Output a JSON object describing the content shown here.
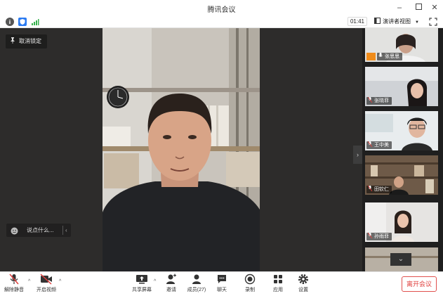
{
  "window": {
    "title": "腾讯会议"
  },
  "infobar": {
    "timer": "01:41",
    "view_mode": "演讲者视图"
  },
  "stage": {
    "pinned_label": "取消锁定",
    "chat_placeholder": "说点什么..."
  },
  "participants": [
    {
      "name": "张思思"
    },
    {
      "name": "张晓菲"
    },
    {
      "name": "王中美"
    },
    {
      "name": "田钦仁"
    },
    {
      "name": "孙雨菲"
    },
    {
      "name": ""
    }
  ],
  "toolbar": {
    "mute": "解除静音",
    "video": "开启视频",
    "share": "共享屏幕",
    "invite": "邀请",
    "members": "成员(27)",
    "chat": "聊天",
    "record": "录制",
    "apps": "应用",
    "settings": "设置",
    "leave": "离开会议"
  },
  "colors": {
    "accent_blue": "#2b7bf2",
    "danger": "#e0403e",
    "signal": "#37b24d"
  }
}
